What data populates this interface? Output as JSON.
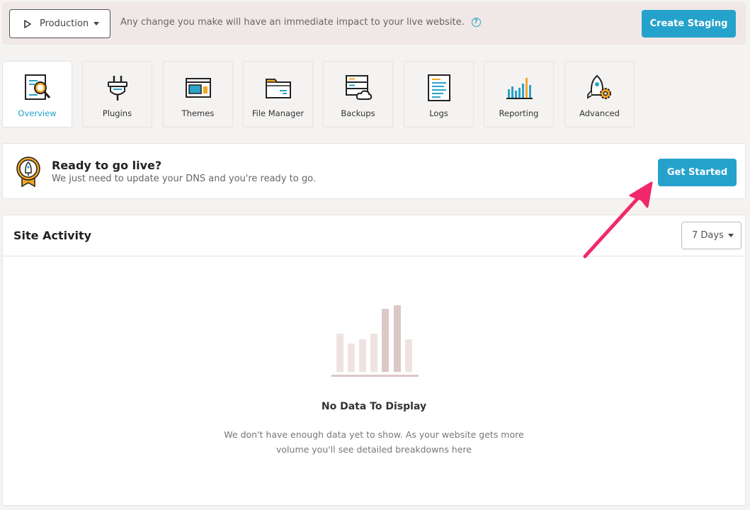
{
  "topbar": {
    "environment": "Production",
    "message": "Any change you make will have an immediate impact to your live website.",
    "create_staging_label": "Create Staging"
  },
  "tabs": [
    {
      "label": "Overview",
      "icon": "overview-icon",
      "active": true
    },
    {
      "label": "Plugins",
      "icon": "plugin-icon"
    },
    {
      "label": "Themes",
      "icon": "themes-icon"
    },
    {
      "label": "File Manager",
      "icon": "folder-icon"
    },
    {
      "label": "Backups",
      "icon": "backups-icon"
    },
    {
      "label": "Logs",
      "icon": "logs-icon"
    },
    {
      "label": "Reporting",
      "icon": "reporting-icon"
    },
    {
      "label": "Advanced",
      "icon": "advanced-icon"
    }
  ],
  "golive": {
    "title": "Ready to go live?",
    "subtitle": "We just need to update your DNS and you're ready to go.",
    "button_label": "Get Started"
  },
  "activity": {
    "title": "Site Activity",
    "range": "7 Days",
    "empty_title": "No Data To Display",
    "empty_desc_line1": "We don't have enough data yet to show. As your website gets more",
    "empty_desc_line2": "volume you'll see detailed breakdowns here"
  },
  "colors": {
    "accent": "#25a2cc",
    "arrow": "#f0286a",
    "banner": "#f0e8e6"
  }
}
